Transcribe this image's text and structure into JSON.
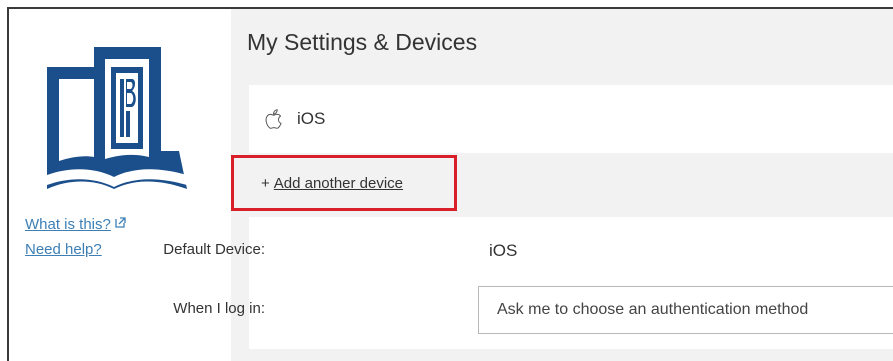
{
  "sidebar": {
    "logo_name": "logo-icon",
    "what_is_this": "What is this?",
    "need_help": "Need help?"
  },
  "main": {
    "title": "My Settings & Devices",
    "device": {
      "icon": "apple-icon",
      "name": "iOS"
    },
    "add_device": {
      "plus": "+",
      "label": "Add another device"
    },
    "default_device": {
      "label": "Default Device:",
      "value": "iOS"
    },
    "when_log_in": {
      "label": "When I log in:",
      "selected": "Ask me to choose an authentication method"
    }
  },
  "colors": {
    "logo_blue": "#1b4f8c",
    "link_blue": "#3d7fb5",
    "highlight_red": "#d9202a",
    "panel_gray": "#f2f2f2"
  }
}
